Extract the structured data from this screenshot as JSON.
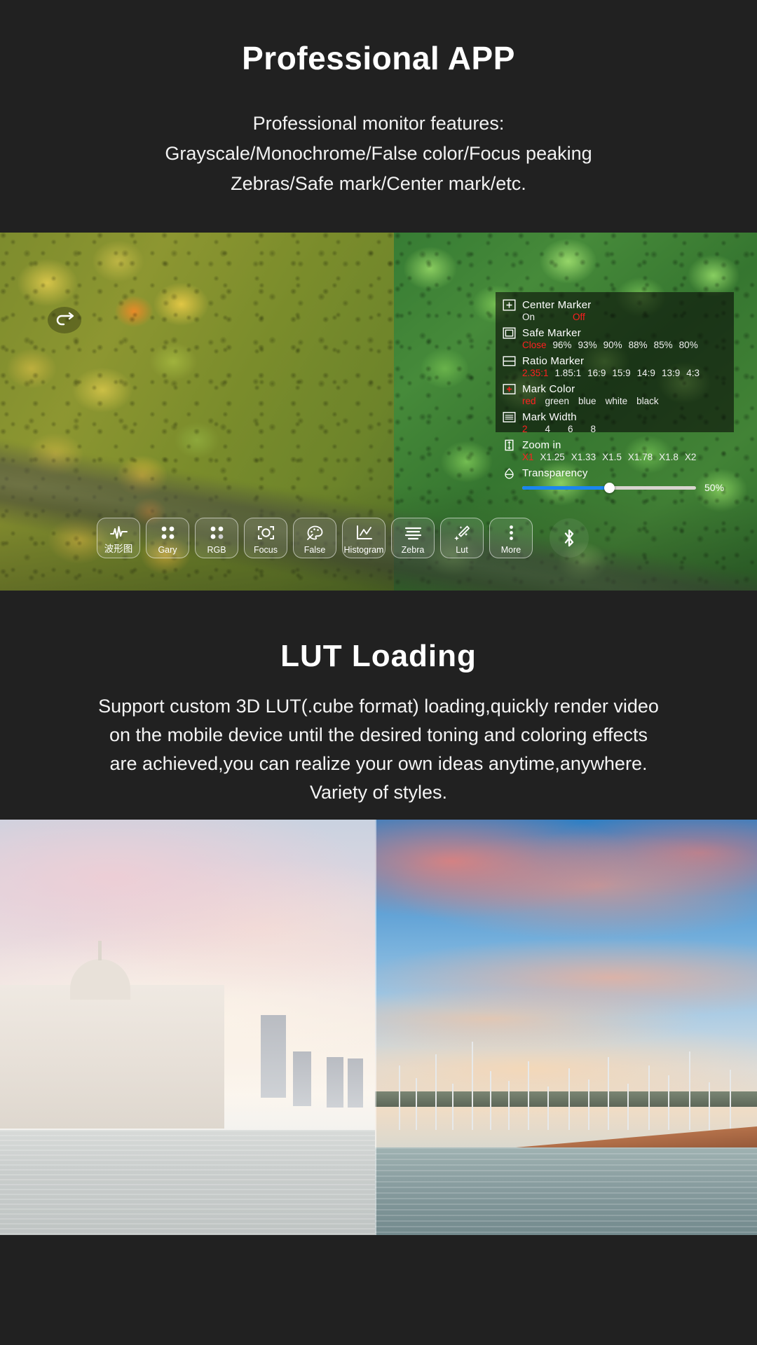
{
  "section1": {
    "title": "Professional APP",
    "subtitle_lines": [
      "Professional monitor features:",
      "Grayscale/Monochrome/False color/Focus peaking",
      "Zebras/Safe mark/Center mark/etc."
    ]
  },
  "monitor": {
    "back_icon": "back-arrow-icon",
    "panel": {
      "rows": [
        {
          "icon": "center-marker-icon",
          "label": "Center Marker",
          "options": [
            "On",
            "Off"
          ],
          "selected": "Off"
        },
        {
          "icon": "safe-marker-icon",
          "label": "Safe Marker",
          "options": [
            "Close",
            "96%",
            "93%",
            "90%",
            "88%",
            "85%",
            "80%"
          ],
          "selected": "Close"
        },
        {
          "icon": "ratio-marker-icon",
          "label": "Ratio Marker",
          "options": [
            "2.35:1",
            "1.85:1",
            "16:9",
            "15:9",
            "14:9",
            "13:9",
            "4:3"
          ],
          "selected": "2.35:1"
        },
        {
          "icon": "mark-color-icon",
          "label": "Mark Color",
          "options": [
            "red",
            "green",
            "blue",
            "white",
            "black"
          ],
          "selected": "red"
        },
        {
          "icon": "mark-width-icon",
          "label": "Mark Width",
          "options": [
            "2",
            "4",
            "6",
            "8"
          ],
          "selected": "2"
        },
        {
          "icon": "zoom-in-icon",
          "label": "Zoom in",
          "options": [
            "X1",
            "X1.25",
            "X1.33",
            "X1.5",
            "X1.78",
            "X1.8",
            "X2"
          ],
          "selected": "X1"
        }
      ],
      "transparency": {
        "icon": "transparency-icon",
        "label": "Transparency",
        "value": "50%",
        "percent": 50,
        "fill_color": "#1a86f0"
      },
      "accent_color": "#ff2020"
    },
    "toolbar": [
      {
        "label": "波形图",
        "icon": "waveform-icon"
      },
      {
        "label": "Gary",
        "icon": "grayscale-dots-icon"
      },
      {
        "label": "RGB",
        "icon": "rgb-dots-icon"
      },
      {
        "label": "Focus",
        "icon": "focus-frame-icon"
      },
      {
        "label": "False",
        "icon": "palette-icon"
      },
      {
        "label": "Histogram",
        "icon": "histogram-icon"
      },
      {
        "label": "Zebra",
        "icon": "zebra-lines-icon"
      },
      {
        "label": "Lut",
        "icon": "magic-wand-icon"
      },
      {
        "label": "More",
        "icon": "more-dots-icon"
      },
      {
        "label": "",
        "icon": "bluetooth-icon"
      }
    ]
  },
  "section2": {
    "title": "LUT  Loading",
    "subtitle_lines": [
      "Support custom 3D LUT(.cube format) loading,quickly render video",
      "on the mobile device until the desired toning and coloring effects",
      "are achieved,you can realize your own ideas anytime,anywhere.",
      "Variety of styles."
    ]
  },
  "lut_compare": {
    "left_label": "ungraded-flat-image",
    "right_label": "graded-lut-applied-image"
  }
}
